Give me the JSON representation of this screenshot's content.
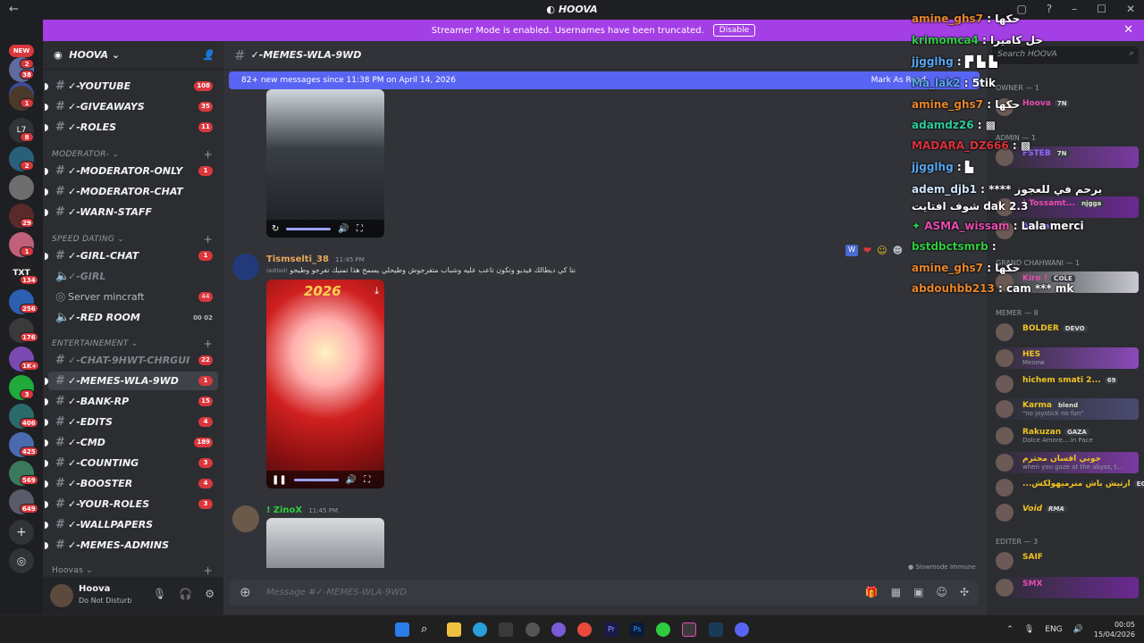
{
  "titlebar": {
    "title": "HOOVA"
  },
  "banner": {
    "text": "Streamer Mode is enabled. Usernames have been truncated.",
    "button": "Disable"
  },
  "guild_badges": {
    "new": "NEW",
    "b1": "2",
    "b2": "38",
    "b3": "1",
    "b4": "L7",
    "b5": "8",
    "b6": "2",
    "b7": "29",
    "b8": "1",
    "b9": "134",
    "b10": "256",
    "b11": "176",
    "b12": "1K+",
    "b13": "3",
    "b14": "406",
    "b15": "425",
    "b16": "569",
    "b17": "649"
  },
  "server": {
    "name": "HOOVA"
  },
  "channels": [
    {
      "name": "✓-YOUTUBE",
      "badge": "108"
    },
    {
      "name": "✓-GIVEAWAYS",
      "badge": "35"
    },
    {
      "name": "✓-ROLES",
      "badge": "11"
    },
    {
      "category": "MODERATOR-"
    },
    {
      "name": "✓-MODERATOR-ONLY",
      "badge": "1"
    },
    {
      "name": "✓-MODERATOR-CHAT"
    },
    {
      "name": "✓-WARN-STAFF"
    },
    {
      "category": "SPEED DATING"
    },
    {
      "name": "✓-GIRL-CHAT",
      "badge": "1"
    },
    {
      "name": "✓-GIRL"
    },
    {
      "name": "Server mincraft",
      "badge": "44"
    },
    {
      "name": "✓-RED ROOM",
      "users": "00",
      "cap": "02"
    },
    {
      "category": "ENTERTAINEMENT"
    },
    {
      "name": "✓-CHAT-9HWT-CHRGUI",
      "badge": "22"
    },
    {
      "name": "✓-MEMES-WLA-9WD",
      "badge": "1"
    },
    {
      "name": "✓-BANK-RP",
      "badge": "15"
    },
    {
      "name": "✓-EDITS",
      "badge": "4"
    },
    {
      "name": "✓-CMD",
      "badge": "189"
    },
    {
      "name": "✓-COUNTING",
      "badge": "3"
    },
    {
      "name": "✓-BOOSTER",
      "badge": "4"
    },
    {
      "name": "✓-YOUR-ROLES",
      "badge": "3"
    },
    {
      "name": "✓-WALLPAPERS"
    },
    {
      "name": "✓-MEMES-ADMINS"
    },
    {
      "category": "Hoovas"
    }
  ],
  "user": {
    "name": "Hoova",
    "status": "Do Not Disturb"
  },
  "channel_header": {
    "name": "✓-MEMES-WLA-9WD"
  },
  "new_messages": {
    "text": "82+ new messages since 11:38 PM on April 14, 2026",
    "mark": "Mark As Read"
  },
  "messages": [
    {
      "author": "Tismselti_38",
      "time": "11:45 PM",
      "edited": "(edited)",
      "text": "نتا كي ديطالك فيديو وتكون تاعب عليه وشباب متفرجوش وطيحلي يسمح هذا تمنيك تفرجو وطيحو",
      "media_label": "2026"
    },
    {
      "author": "ZinoX",
      "prefix": "!",
      "time": "11:45 PM"
    }
  ],
  "composer": {
    "placeholder": "Message #✓-MEMES-WLA-9WD"
  },
  "slowmode": "Slowmode Immune",
  "members": {
    "search_placeholder": "Search HOOVA",
    "groups": [
      {
        "title": "Owner — 1",
        "items": [
          {
            "name": "Hoova",
            "tag": "7N",
            "color": "#e84cae"
          }
        ]
      },
      {
        "title": "Admin — 1",
        "items": [
          {
            "name": "FSTEB",
            "tag": "7N",
            "color": "#8e6bff"
          }
        ]
      },
      {
        "title": "",
        "items": [
          {
            "name": "! Tossamt...",
            "tag": "njgga",
            "color": "#e84cae"
          },
          {
            "name": "Akaza",
            "tag": "",
            "color": "#8e6bff"
          }
        ]
      },
      {
        "title": "GRAND CHAHWANI — 1",
        "items": [
          {
            "name": "Kiro !",
            "tag": "ᑕOᒪE",
            "color": "#e84cae"
          }
        ]
      },
      {
        "title": "Memer — 8",
        "items": [
          {
            "name": "BOLDER",
            "tag": "DEVO",
            "color": "#f0c420",
            "sub": ""
          },
          {
            "name": "HES",
            "tag": "",
            "color": "#f0c420",
            "sub": "Meoow"
          },
          {
            "name": "hichem smati 2...",
            "tag": "69",
            "color": "#f0c420",
            "sub": ""
          },
          {
            "name": "Karma",
            "tag": "blend",
            "color": "#f0c420",
            "sub": "\"no joystick no fun\""
          },
          {
            "name": "Rakuzan",
            "tag": "GAZA",
            "color": "#f0c420",
            "sub": "Dolce Amore....in Pace"
          },
          {
            "name": "جوني اقسان محترم",
            "tag": "",
            "color": "#f0c420",
            "sub": "when you gaze at the abyss, t..."
          },
          {
            "name": "...ارتيش باش منرميهولكش",
            "tag": "EGO",
            "color": "#f0c420",
            "sub": ""
          },
          {
            "name": "Void",
            "tag": "RMA",
            "color": "#f0c420",
            "sub": ""
          }
        ]
      },
      {
        "title": "Editer — 3",
        "items": [
          {
            "name": "SAIF",
            "tag": "",
            "color": "#f0c420"
          },
          {
            "name": "SMX",
            "tag": "",
            "color": "#e84cae"
          }
        ]
      }
    ]
  },
  "overlay_chat": [
    {
      "user": "amine_ghs7",
      "msg": "حكها",
      "color": "#e8862a"
    },
    {
      "user": "krimomca4",
      "msg": "حل كاميرا",
      "color": "#2ecc40"
    },
    {
      "user": "jjgglhg",
      "msg": "",
      "color": "#5aa5f0"
    },
    {
      "user": "Ma_lak2",
      "msg": "5tik",
      "color": "#5aa5f0"
    },
    {
      "user": "amine_ghs7",
      "msg": "حكها",
      "color": "#e8862a"
    },
    {
      "user": "adamdz26",
      "msg": "",
      "color": "#2ecc9a"
    },
    {
      "user": "MADARA_DZ666",
      "msg": "",
      "color": "#d9323c"
    },
    {
      "user": "jjgglhg",
      "msg": "",
      "color": "#5aa5f0"
    },
    {
      "user": "adem_djb1",
      "msg": "برحم في للعجوز **** شوف افتايت dak 2.3",
      "color": "#cfe3ff"
    },
    {
      "user": "ASMA_wissam",
      "msg": "Lala merci",
      "color": "#e84cae"
    },
    {
      "user": "bstdbctsmrb",
      "msg": "",
      "color": "#2ecc40"
    },
    {
      "user": "amine_ghs7",
      "msg": "حكها",
      "color": "#e8862a"
    },
    {
      "user": "abdouhbb213",
      "msg": "cam *** mk",
      "color": "#e8862a"
    }
  ],
  "taskbar": {
    "lang": "ENG",
    "time": "00:05",
    "date": "15/04/2026"
  },
  "colors": {
    "accent": "#5865f2",
    "banner": "#a43fe6",
    "badge": "#da373c"
  }
}
